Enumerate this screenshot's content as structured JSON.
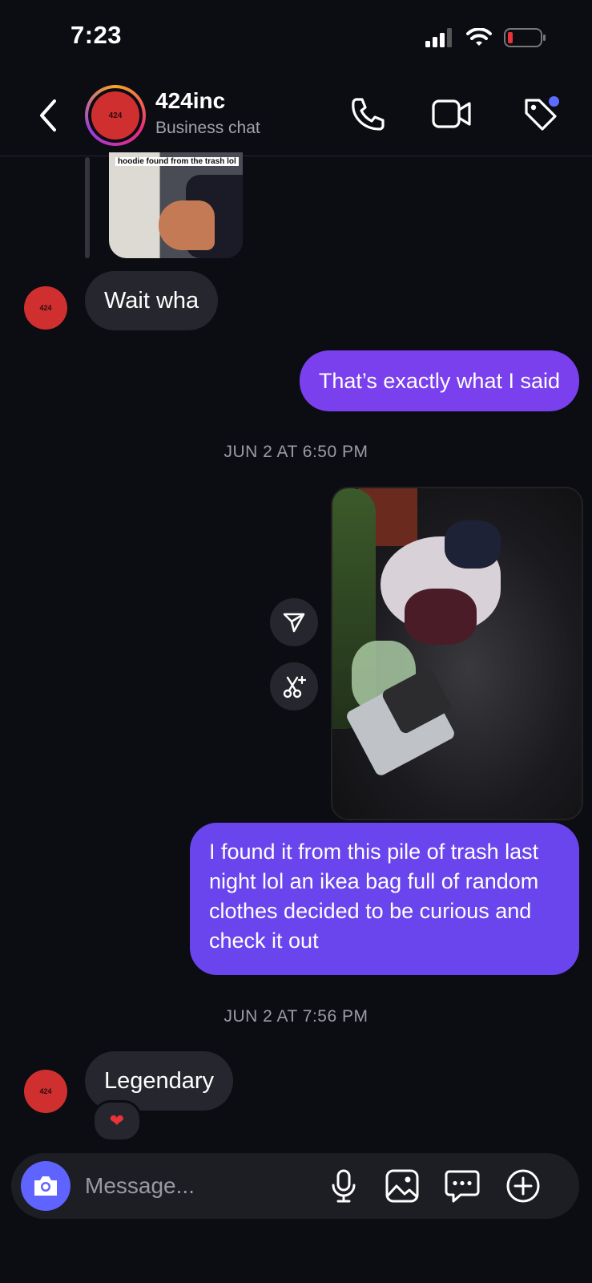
{
  "status_bar": {
    "time": "7:23"
  },
  "header": {
    "name": "424inc",
    "subtitle": "Business chat",
    "avatar_text": "424"
  },
  "reply_preview": {
    "caption": "hoodie found from the trash lol"
  },
  "messages": [
    {
      "direction": "incoming",
      "text": "Wait wha",
      "avatar_text": "424"
    },
    {
      "direction": "outgoing",
      "text": "That’s exactly what I said"
    },
    {
      "type": "timestamp",
      "text": "JUN 2 AT 6:50 PM"
    },
    {
      "direction": "outgoing",
      "type": "photo"
    },
    {
      "direction": "outgoing",
      "text": "I found it from this pile of trash last night lol an ikea bag full of random clothes decided to be curious and check it out"
    },
    {
      "type": "timestamp",
      "text": "JUN 2 AT 7:56 PM"
    },
    {
      "direction": "incoming",
      "text": "Legendary",
      "avatar_text": "424",
      "reaction": "❤"
    }
  ],
  "composer": {
    "placeholder": "Message..."
  },
  "colors": {
    "outgoing_bubble": "#7a40ee",
    "incoming_bubble": "#26272e",
    "background": "#0c0c13",
    "accent": "#5f63ff",
    "avatar": "#cf2f2f"
  },
  "icons": [
    "back-icon",
    "phone-icon",
    "video-icon",
    "tag-icon",
    "send-icon",
    "cut-sparkle-icon",
    "camera-icon",
    "microphone-icon",
    "gallery-icon",
    "sticker-icon",
    "plus-icon"
  ]
}
